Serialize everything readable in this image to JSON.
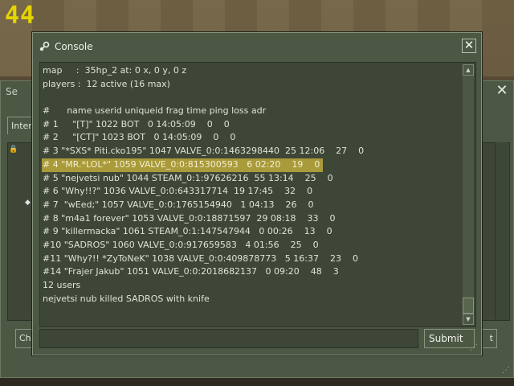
{
  "hud": {
    "fps": "44"
  },
  "background_window": {
    "title": "Se",
    "tab_label": "Inter",
    "left_button": "Cha",
    "right_button": "t",
    "close": "✕"
  },
  "console": {
    "title": "Console",
    "close": "✕",
    "lines": [
      "map     :  35hp_2 at: 0 x, 0 y, 0 z",
      "players :  12 active (16 max)",
      "",
      "#      name userid uniqueid frag time ping loss adr",
      "# 1     \"[T]\" 1022 BOT   0 14:05:09    0    0",
      "# 2     \"[CT]\" 1023 BOT   0 14:05:09    0    0",
      "# 3 \"*SXS* Piti.cko195\" 1047 VALVE_0:0:1463298440  25 12:06    27    0",
      "# 4 \"MR.*LOL*\" 1059 VALVE_0:0:815300593   6 02:20    19    0",
      "# 5 \"nejvetsi nub\" 1044 STEAM_0:1:97626216  55 13:14    25    0",
      "# 6 \"Why!!?\" 1036 VALVE_0:0:643317714  19 17:45    32    0",
      "# 7  \"wEed;\" 1057 VALVE_0:0:1765154940   1 04:13    26    0",
      "# 8 \"m4a1 forever\" 1053 VALVE_0:0:18871597  29 08:18    33    0",
      "# 9 \"killermacka\" 1061 STEAM_0:1:147547944   0 00:26    13    0",
      "#10 \"SADROS\" 1060 VALVE_0:0:917659583   4 01:56    25    0",
      "#11 \"Why?!! *ZyToNeK\" 1038 VALVE_0:0:409878773   5 16:37    23    0",
      "#14 \"Frajer Jakub\" 1051 VALVE_0:0:2018682137   0 09:20    48    3",
      "12 users",
      "nejvetsi nub killed SADROS with knife"
    ],
    "highlighted_line_index": 7,
    "input_value": "",
    "submit_label": "Submit"
  },
  "colors": {
    "panel": "#4c5844",
    "highlight": "#a99a3a",
    "fps": "#e4d400"
  }
}
